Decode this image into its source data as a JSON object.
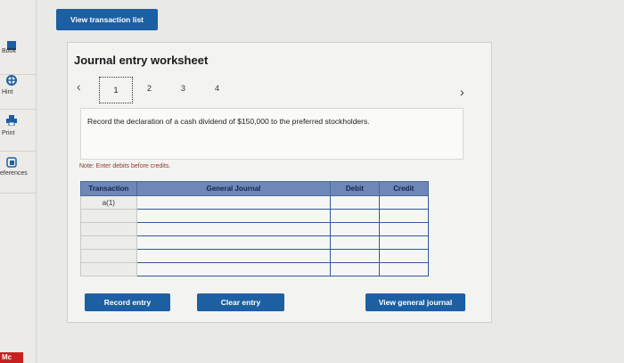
{
  "rail": {
    "items": [
      {
        "label": "Book",
        "icon": "book-icon"
      },
      {
        "label": "Hint",
        "icon": "lifebuoy-icon"
      },
      {
        "label": "Print",
        "icon": "printer-icon"
      },
      {
        "label": "eferences",
        "icon": "references-icon"
      }
    ],
    "brand": "Mc"
  },
  "toolbar": {
    "view_transactions_label": "View transaction list"
  },
  "worksheet": {
    "title": "Journal entry worksheet",
    "steps": [
      "1",
      "2",
      "3",
      "4"
    ],
    "current_step": "1",
    "prompt": "Record the declaration of a cash dividend of $150,000 to the preferred stockholders.",
    "note": "Note: Enter debits before credits.",
    "table": {
      "headers": [
        "Transaction",
        "General Journal",
        "Debit",
        "Credit"
      ],
      "rows": [
        {
          "transaction": "a(1)",
          "account": "",
          "debit": "",
          "credit": ""
        },
        {
          "transaction": "",
          "account": "",
          "debit": "",
          "credit": ""
        },
        {
          "transaction": "",
          "account": "",
          "debit": "",
          "credit": ""
        },
        {
          "transaction": "",
          "account": "",
          "debit": "",
          "credit": ""
        },
        {
          "transaction": "",
          "account": "",
          "debit": "",
          "credit": ""
        },
        {
          "transaction": "",
          "account": "",
          "debit": "",
          "credit": ""
        }
      ]
    },
    "buttons": {
      "record": "Record entry",
      "clear": "Clear entry",
      "view_journal": "View general journal"
    }
  },
  "colors": {
    "primary_button": "#1c5fa3",
    "header_fill": "#6c87b8",
    "brand_red": "#c8201e"
  }
}
